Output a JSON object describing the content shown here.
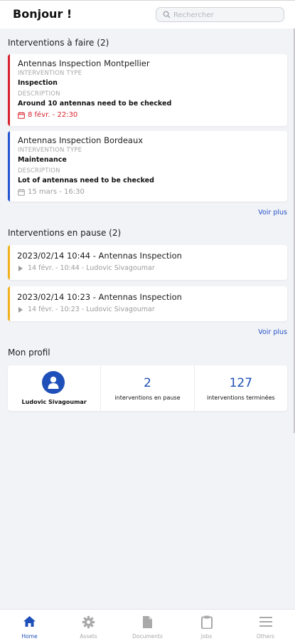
{
  "header": {
    "greeting": "Bonjour !",
    "search_placeholder": "Rechercher"
  },
  "todo": {
    "title": "Interventions à faire (2)",
    "items": [
      {
        "name": "Antennas Inspection Montpellier",
        "type_label": "INTERVENTION TYPE",
        "type_value": "Inspection",
        "desc_label": "DESCRIPTION",
        "desc_value": "Around 10 antennas need to be checked",
        "date": "8 févr. - 22:30",
        "accent": "#d8222e",
        "date_color": "#d8222e"
      },
      {
        "name": "Antennas Inspection Bordeaux",
        "type_label": "INTERVENTION TYPE",
        "type_value": "Maintenance",
        "desc_label": "DESCRIPTION",
        "desc_value": "Lot of antennas need to be checked",
        "date": "15 mars - 16:30",
        "accent": "#2355d0",
        "date_color": "#9c9c9c"
      }
    ],
    "more": "Voir plus"
  },
  "paused": {
    "title": "Interventions en pause (2)",
    "items": [
      {
        "name": "2023/02/14 10:44 - Antennas Inspection",
        "sub": "14 févr. - 10:44 - Ludovic Sivagoumar",
        "accent": "#f0b21c"
      },
      {
        "name": "2023/02/14 10:23 - Antennas Inspection",
        "sub": "14 févr. - 10:23 - Ludovic Sivagoumar",
        "accent": "#f0b21c"
      }
    ],
    "more": "Voir plus"
  },
  "profile": {
    "title": "Mon profil",
    "user": "Ludovic Sivagoumar",
    "paused_count": "2",
    "paused_label": "interventions en pause",
    "done_count": "127",
    "done_label": "interventions terminées"
  },
  "tabs": [
    {
      "label": "Home",
      "icon": "home-icon",
      "active": true
    },
    {
      "label": "Assets",
      "icon": "gear-icon",
      "active": false
    },
    {
      "label": "Documents",
      "icon": "document-icon",
      "active": false
    },
    {
      "label": "Jobs",
      "icon": "clipboard-icon",
      "active": false
    },
    {
      "label": "Others",
      "icon": "menu-icon",
      "active": false
    }
  ],
  "colors": {
    "brand": "#1f4fb8",
    "danger": "#d8222e",
    "warning": "#f0b21c"
  }
}
